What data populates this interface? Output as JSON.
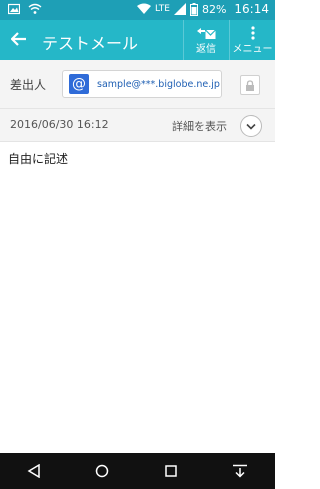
{
  "status_bar": {
    "left_icons": [
      "image-icon",
      "wifi-icon"
    ],
    "right_icons": [
      "wifi-icon",
      "lte-signal-icon",
      "signal-icon",
      "battery-icon"
    ],
    "network": "LTE",
    "battery": "82%",
    "time": "16:14"
  },
  "app_bar": {
    "title": "テストメール",
    "reply_label": "返信",
    "menu_label": "メニュー"
  },
  "sender": {
    "label": "差出人",
    "address": "sample@***.biglobe.ne.jp",
    "icon": "@"
  },
  "meta": {
    "date": "2016/06/30 16:12",
    "detail_label": "詳細を表示"
  },
  "message": {
    "body": "自由に記述"
  },
  "nav_bar": {
    "buttons": [
      "back-icon",
      "home-icon",
      "recents-icon",
      "keyboard-hide-icon"
    ]
  },
  "colors": {
    "status_bar": "#1e9fb6",
    "app_bar": "#25b7c8",
    "address_link": "#1f5fb3",
    "at_icon_bg": "#2f6bd8"
  }
}
